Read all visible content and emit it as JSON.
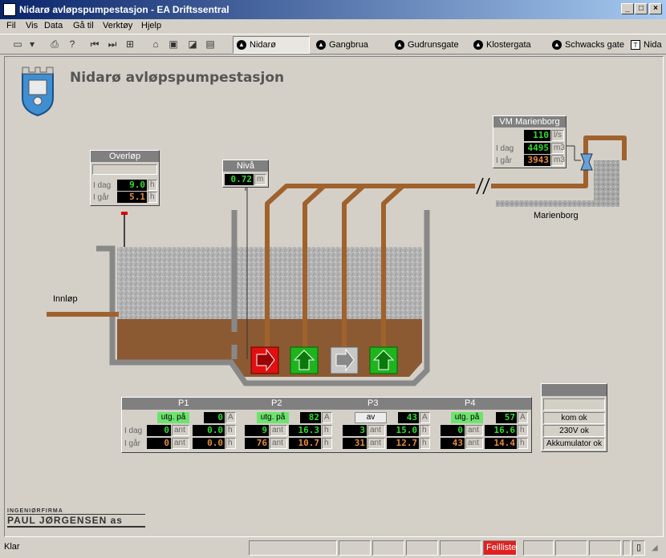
{
  "window": {
    "title": "Nidarø avløpspumpestasjon - EA Driftssentral"
  },
  "menu": [
    "Fil",
    "Vis",
    "Data",
    "Gå til",
    "Verktøy",
    "Hjelp"
  ],
  "tabs": [
    "Nidarø",
    "Gangbrua",
    "Gudrunsgate",
    "Klostergata",
    "Schwacks gate",
    "Nida"
  ],
  "page": {
    "heading": "Nidarø avløpspumpestasjon"
  },
  "overflow": {
    "title": "Overløp",
    "today_label": "I dag",
    "today": "9.0",
    "yesterday_label": "I går",
    "yesterday": "5.1",
    "unit": "h"
  },
  "level": {
    "title": "Nivå",
    "value": "0.72",
    "unit": "m"
  },
  "meter": {
    "title": "VM Marienborg",
    "flow": "110",
    "flow_unit": "l/s",
    "today_label": "I dag",
    "today": "4495",
    "today_unit": "m3",
    "yesterday_label": "I går",
    "yesterday": "3943",
    "yesterday_unit": "m3"
  },
  "labels": {
    "inlet": "Innløp",
    "outlet": "Marienborg"
  },
  "pumps_table": {
    "row_labels": {
      "today": "I dag",
      "yesterday": "I går"
    },
    "units": {
      "a": "A",
      "ant": "ant",
      "h": "h"
    },
    "pumps": [
      {
        "name": "P1",
        "status": "utg. på",
        "status_on": true,
        "current": "0",
        "starts_today": "0",
        "hours_today": "0.0",
        "starts_yesterday": "0",
        "hours_yesterday": "0.0"
      },
      {
        "name": "P2",
        "status": "utg. på",
        "status_on": true,
        "current": "82",
        "starts_today": "9",
        "hours_today": "16.3",
        "starts_yesterday": "76",
        "hours_yesterday": "10.7"
      },
      {
        "name": "P3",
        "status": "av",
        "status_on": false,
        "current": "43",
        "starts_today": "3",
        "hours_today": "15.0",
        "starts_yesterday": "31",
        "hours_yesterday": "12.7"
      },
      {
        "name": "P4",
        "status": "utg. på",
        "status_on": true,
        "current": "57",
        "starts_today": "0",
        "hours_today": "16.6",
        "starts_yesterday": "43",
        "hours_yesterday": "14.4"
      }
    ]
  },
  "system": {
    "com": "kom ok",
    "power": "230V ok",
    "battery": "Akkumulator ok"
  },
  "company": {
    "line1": "INGENIØRFIRMA",
    "line2": "PAUL JØRGENSEN as"
  },
  "statusbar": {
    "text": "Klar",
    "alarm": "Feilliste"
  },
  "colors": {
    "pipe": "#a0622d",
    "sludge": "#8b5a33",
    "water": "#b0b0b0",
    "pump_on": "#1db51d",
    "pump_fault": "#e01010",
    "pump_off": "#c8c8c8"
  }
}
